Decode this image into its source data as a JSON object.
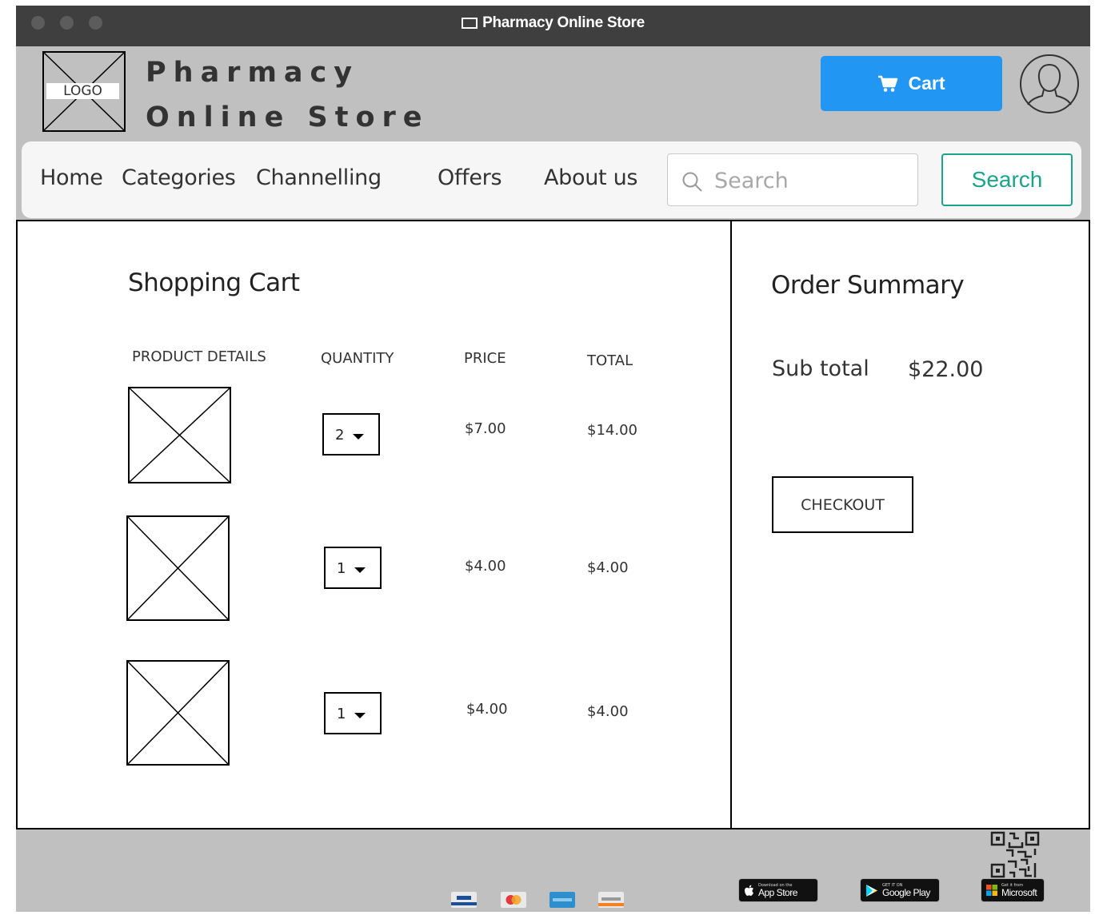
{
  "window": {
    "title": "Pharmacy Online Store"
  },
  "header": {
    "logo_label": "LOGO",
    "brand_line1": "Pharmacy",
    "brand_line2": "Online Store",
    "cart_label": "Cart",
    "colors": {
      "header_bg": "#c0c0c0",
      "cart_button": "#2196f3",
      "search_accent": "#1aa58a"
    }
  },
  "nav": {
    "items": [
      "Home",
      "Categories",
      "Channelling",
      "Offers",
      "About us"
    ],
    "search_placeholder": "Search",
    "search_button": "Search"
  },
  "cart": {
    "title": "Shopping Cart",
    "columns": [
      "PRODUCT DETAILS",
      "QUANTITY",
      "PRICE",
      "TOTAL"
    ],
    "rows": [
      {
        "quantity": "2",
        "price": "$7.00",
        "total": "$14.00"
      },
      {
        "quantity": "1",
        "price": "$4.00",
        "total": "$4.00"
      },
      {
        "quantity": "1",
        "price": "$4.00",
        "total": "$4.00"
      }
    ]
  },
  "summary": {
    "title": "Order Summary",
    "subtotal_label": "Sub total",
    "subtotal_value": "$22.00",
    "checkout_label": "CHECKOUT"
  },
  "footer": {
    "payment_icons": [
      "visa-icon",
      "mastercard-icon",
      "amex-icon",
      "discover-icon"
    ],
    "app_badges": [
      {
        "icon": "apple-icon",
        "small": "Download on the",
        "big": "App Store"
      },
      {
        "icon": "google-play-icon",
        "small": "GET IT ON",
        "big": "Google Play"
      },
      {
        "icon": "microsoft-icon",
        "small": "Get it from",
        "big": "Microsoft"
      }
    ]
  }
}
